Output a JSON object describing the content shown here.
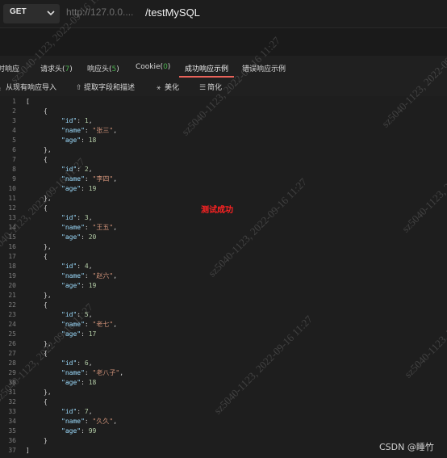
{
  "request": {
    "method": "GET",
    "url_host": "http://127.0.0....",
    "url_path": "/testMySQL"
  },
  "tabs": [
    {
      "label": "实时响应",
      "count": ""
    },
    {
      "label": "请求头(",
      "count": "7",
      "suffix": ")"
    },
    {
      "label": "响应头(",
      "count": "5",
      "suffix": ")"
    },
    {
      "label": "Cookie(",
      "count": "0",
      "suffix": ")"
    },
    {
      "label": "成功响应示例",
      "count": "",
      "active": true
    },
    {
      "label": "错误响应示例",
      "count": ""
    }
  ],
  "toolbar": {
    "import": "从现有响应导入",
    "extract": "提取字段和描述",
    "beautify": "美化",
    "simplify": "简化"
  },
  "line_numbers": [
    "1",
    "2",
    "3",
    "4",
    "5",
    "6",
    "7",
    "8",
    "9",
    "10",
    "11",
    "12",
    "13",
    "14",
    "15",
    "16",
    "17",
    "18",
    "19",
    "20",
    "21",
    "22",
    "23",
    "24",
    "25",
    "26",
    "27",
    "28",
    "29",
    "30",
    "31",
    "32",
    "33",
    "34",
    "35",
    "36",
    "37"
  ],
  "response_records": [
    {
      "id": "1",
      "name": "\"张三\"",
      "age": "18"
    },
    {
      "id": "2",
      "name": "\"李四\"",
      "age": "19"
    },
    {
      "id": "3",
      "name": "\"王五\"",
      "age": "20"
    },
    {
      "id": "4",
      "name": "\"赵六\"",
      "age": "19"
    },
    {
      "id": "5",
      "name": "\"老七\"",
      "age": "17"
    },
    {
      "id": "6",
      "name": "\"老八子\"",
      "age": "18"
    },
    {
      "id": "7",
      "name": "\"久久\"",
      "age": "99"
    }
  ],
  "json_tokens": {
    "open_bracket": "[",
    "close_bracket": "]",
    "open_brace": "{",
    "close_brace": "}",
    "close_brace_comma": "},",
    "key_id": "\"id\"",
    "key_name": "\"name\"",
    "key_age": "\"age\""
  },
  "annotation": "测试成功",
  "watermark": "sz5040-1123, 2022-09-16 11:27",
  "footer": "CSDN @睡竹",
  "colors": {
    "background": "#1e1e1e",
    "key": "#9cdcfe",
    "string": "#ce9178",
    "number": "#b5cea8",
    "tab_count": "#4caf50",
    "active_tab_underline": "#e8625a",
    "annotation": "#ff2222"
  },
  "icons": [
    "chevron-down-icon",
    "import-icon",
    "upload-icon",
    "beautify-icon",
    "simplify-icon"
  ]
}
